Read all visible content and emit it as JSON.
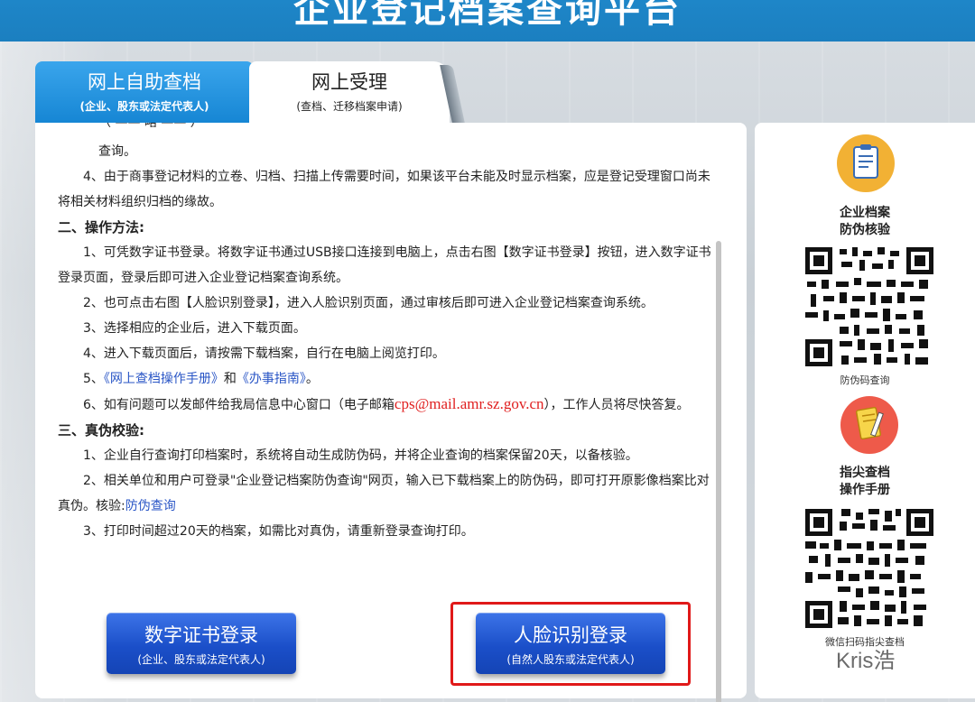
{
  "header": {
    "title": "企业登记档案查询平台"
  },
  "tabs": [
    {
      "label": "网上自助查档",
      "sub": "(企业、股东或法定代表人)"
    },
    {
      "label": "网上受理",
      "sub": "(查档、迁移档案申请)"
    }
  ],
  "content": {
    "line_query": "查询。",
    "item4": "4、由于商事登记材料的立卷、归档、扫描上传需要时间，如果该平台未能及时显示档案，应是登记受理窗口尚未将相关材料组织归档的缘故。",
    "sec2": "二、操作方法:",
    "op1": "1、可凭数字证书登录。将数字证书通过USB接口连接到电脑上，点击右图【数字证书登录】按钮，进入数字证书登录页面，登录后即可进入企业登记档案查询系统。",
    "op2": "2、也可点击右图【人脸识别登录】，进入人脸识别页面，通过审核后即可进入企业登记档案查询系统。",
    "op3": "3、选择相应的企业后，进入下载页面。",
    "op4": "4、进入下载页面后，请按需下载档案，自行在电脑上阅览打印。",
    "op5_prefix": "5、",
    "op5_link1": "《网上查档操作手册》",
    "op5_and": "和",
    "op5_link2": "《办事指南》",
    "op5_suffix": "。",
    "op6_prefix": "6、如有问题可以发邮件给我局信息中心窗口（电子邮箱",
    "op6_email": "cps@mail.amr.sz.gov.cn",
    "op6_suffix": "），工作人员将尽快答复。",
    "sec3": "三、真伪校验:",
    "v1": "1、企业自行查询打印档案时，系统将自动生成防伪码，并将企业查询的档案保留20天，以备核验。",
    "v2_text": "2、相关单位和用户可登录\"企业登记档案防伪查询\"网页，输入已下载档案上的防伪码，即可打开原影像档案比对真伪。核验:",
    "v2_link": "防伪查询",
    "v3": "3、打印时间超过20天的档案，如需比对真伪，请重新登录查询打印。"
  },
  "buttons": {
    "cert": {
      "label": "数字证书登录",
      "sub": "(企业、股东或法定代表人)"
    },
    "face": {
      "label": "人脸识别登录",
      "sub": "(自然人股东或法定代表人)"
    }
  },
  "side": {
    "item1_title_line1": "企业档案",
    "item1_title_line2": "防伪核验",
    "item1_caption": "防伪码查询",
    "item2_title_line1": "指尖查档",
    "item2_title_line2": "操作手册",
    "item2_caption": "微信扫码指尖查档"
  },
  "watermark": "Kris浩",
  "colors": {
    "accent": "#1b7fc0",
    "highlight": "#e01919",
    "link": "#2a56c6",
    "email": "#e02020"
  }
}
